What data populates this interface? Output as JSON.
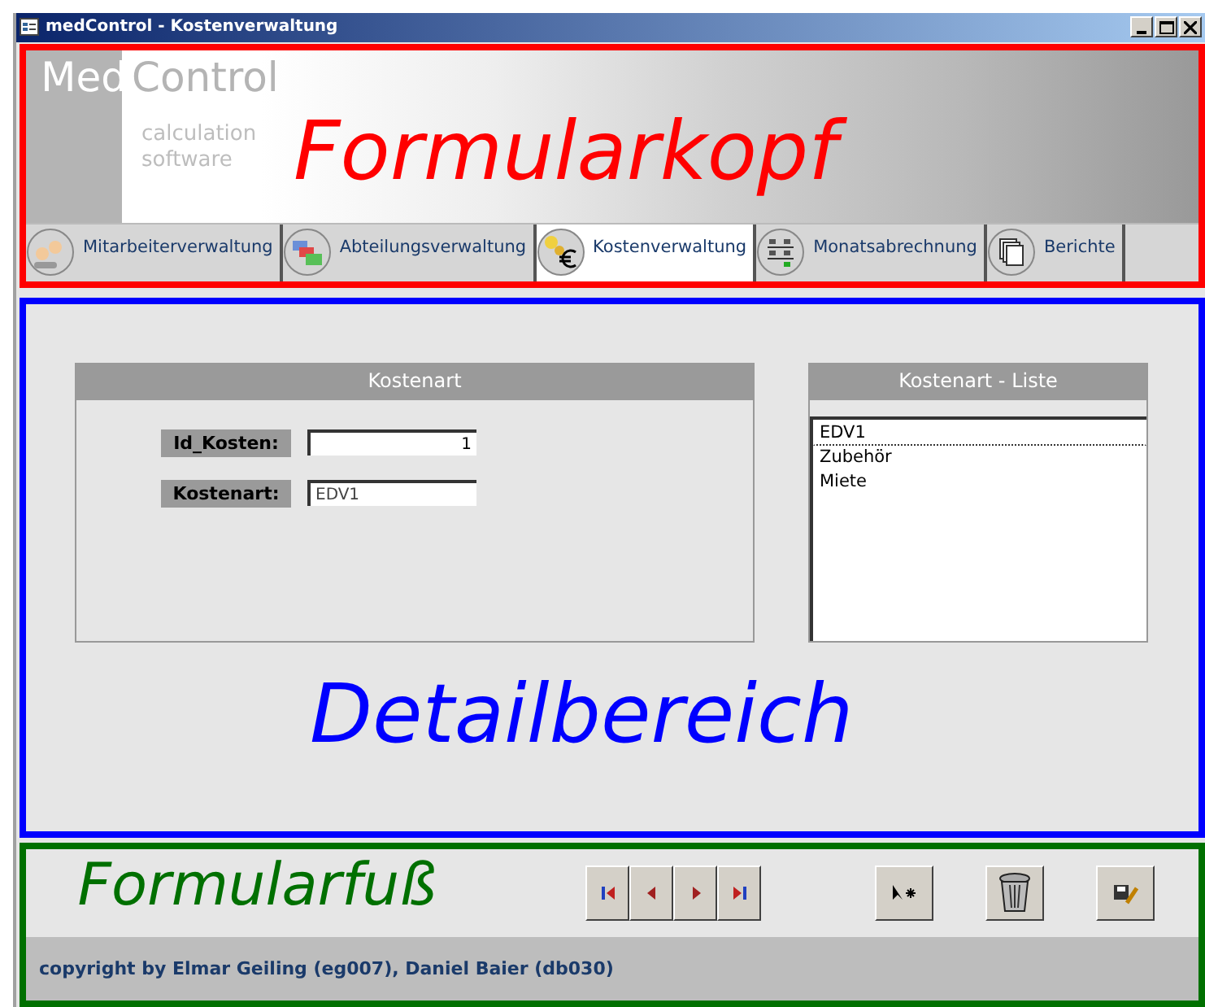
{
  "window": {
    "title": "medControl - Kostenverwaltung"
  },
  "header": {
    "logo_primary": "Med",
    "logo_secondary": "Control",
    "tagline": [
      "calculation",
      "software"
    ],
    "annotation": "Formularkopf",
    "tabs": [
      {
        "label": "Mitarbeiterverwaltung",
        "kind": "people",
        "selected": false
      },
      {
        "label": "Abteilungsverwaltung",
        "kind": "blocks",
        "selected": false
      },
      {
        "label": "Kostenverwaltung",
        "kind": "euro",
        "selected": true
      },
      {
        "label": "Monatsabrechnung",
        "kind": "ledger",
        "selected": false
      },
      {
        "label": "Berichte",
        "kind": "pages",
        "selected": false
      }
    ]
  },
  "detail": {
    "annotation": "Detailbereich",
    "form": {
      "title": "Kostenart",
      "fields": [
        {
          "label": "Id_Kosten:",
          "value": "1"
        },
        {
          "label": "Kostenart:",
          "value": "EDV1"
        }
      ]
    },
    "list": {
      "title": "Kostenart - Liste",
      "items": [
        {
          "text": "EDV1",
          "focused": true
        },
        {
          "text": "Zubehör",
          "focused": false
        },
        {
          "text": "Miete",
          "focused": false
        }
      ]
    }
  },
  "footer": {
    "annotation": "Formularfuß",
    "buttons": [
      {
        "kind": "first"
      },
      {
        "kind": "prev"
      },
      {
        "kind": "next"
      },
      {
        "kind": "last"
      },
      {
        "kind": "new"
      },
      {
        "kind": "delete"
      },
      {
        "kind": "save"
      }
    ],
    "copyright": "copyright by Elmar Geiling (eg007), Daniel Baier (db030)"
  }
}
